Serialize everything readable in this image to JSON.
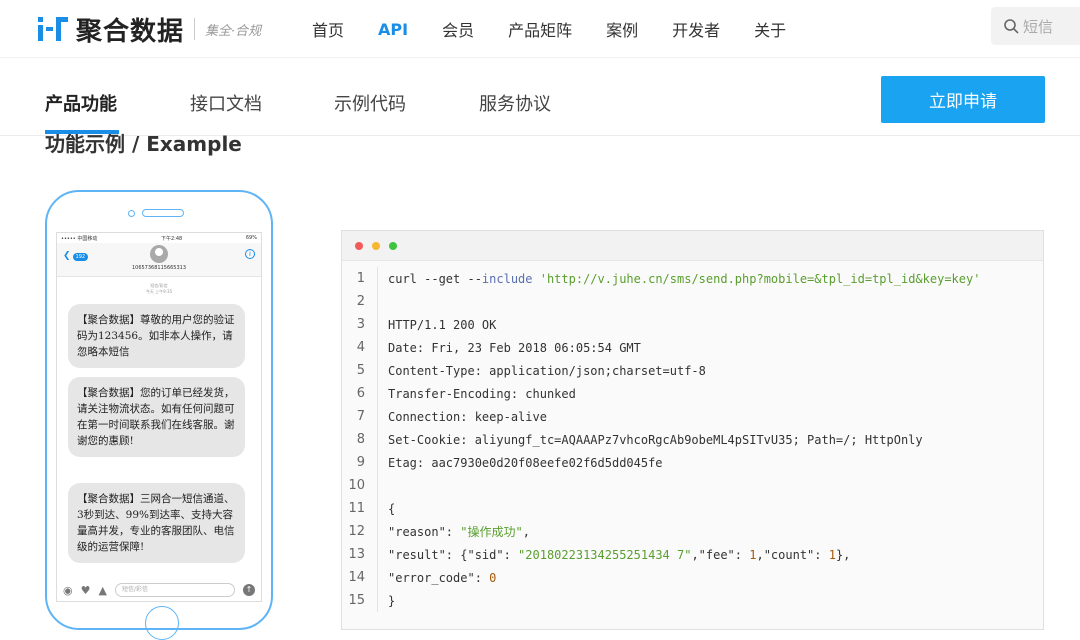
{
  "header": {
    "logo_text": "聚合数据",
    "slogan": "集全·合规",
    "nav": [
      {
        "label": "首页",
        "active": false
      },
      {
        "label": "API",
        "active": true
      },
      {
        "label": "会员",
        "active": false
      },
      {
        "label": "产品矩阵",
        "active": false
      },
      {
        "label": "案例",
        "active": false
      },
      {
        "label": "开发者",
        "active": false
      },
      {
        "label": "关于",
        "active": false
      }
    ],
    "search_placeholder": "短信"
  },
  "subnav": {
    "tabs": [
      "产品功能",
      "接口文档",
      "示例代码",
      "服务协议"
    ],
    "active_index": 0,
    "apply_label": "立即申请"
  },
  "section_title": "功能示例 / Example",
  "phone": {
    "status_left": "••••• 中国移动",
    "status_time": "下午2:48",
    "status_right": "69%",
    "back_badge": "192",
    "sender": "10657368115665313",
    "meta": "短信/彩信\n今天 上午9:35",
    "messages": [
      "【聚合数据】尊敬的用户您的验证码为123456。如非本人操作，请忽略本短信",
      "【聚合数据】您的订单已经发货，请关注物流状态。如有任何问题可在第一时间联系我们在线客服。谢谢您的惠顾!",
      "【聚合数据】三网合一短信通道、3秒到达、99%到达率、支持大容量高并发，专业的客服团队、电信级的运营保障!"
    ],
    "input_placeholder": "短信/彩信"
  },
  "code": {
    "window_dots": [
      "#f25a5a",
      "#f6b731",
      "#3fc43f"
    ],
    "lines": [
      {
        "n": "1",
        "parts": [
          [
            "curl --get --",
            ""
          ],
          [
            "include",
            "kw"
          ],
          [
            " ",
            ""
          ],
          [
            "'http://v.juhe.cn/sms/send.php?mobile=&tpl_id=tpl_id&key=key'",
            "str"
          ]
        ]
      },
      {
        "n": "2",
        "parts": []
      },
      {
        "n": "3",
        "parts": [
          [
            "HTTP/1.1 200 OK",
            ""
          ]
        ]
      },
      {
        "n": "4",
        "parts": [
          [
            "Date: Fri, 23 Feb 2018 06:05:54 GMT",
            ""
          ]
        ]
      },
      {
        "n": "5",
        "parts": [
          [
            "Content-Type: application/json;charset=utf-8",
            ""
          ]
        ]
      },
      {
        "n": "6",
        "parts": [
          [
            "Transfer-Encoding: chunked",
            ""
          ]
        ]
      },
      {
        "n": "7",
        "parts": [
          [
            "Connection: keep-alive",
            ""
          ]
        ]
      },
      {
        "n": "8",
        "parts": [
          [
            "Set-Cookie: aliyungf_tc=AQAAAPz7vhcoRgcAb9obeML4pSITvU35; Path=/; HttpOnly",
            ""
          ]
        ]
      },
      {
        "n": "9",
        "parts": [
          [
            "Etag: aac7930e0d20f08eefe02f6d5dd045fe",
            ""
          ]
        ]
      },
      {
        "n": "10",
        "parts": []
      },
      {
        "n": "11",
        "parts": [
          [
            "{",
            ""
          ]
        ]
      },
      {
        "n": "12",
        "parts": [
          [
            "\"reason\": ",
            ""
          ],
          [
            "\"操作成功\"",
            "str"
          ],
          [
            ",",
            ""
          ]
        ]
      },
      {
        "n": "13",
        "parts": [
          [
            "\"result\": {\"sid\": ",
            ""
          ],
          [
            "\"20180223134255251434 7\"",
            "str"
          ],
          [
            ",\"fee\": ",
            ""
          ],
          [
            "1",
            "num"
          ],
          [
            ",\"count\": ",
            ""
          ],
          [
            "1",
            "num"
          ],
          [
            "},",
            ""
          ]
        ]
      },
      {
        "n": "14",
        "parts": [
          [
            "\"error_code\": ",
            ""
          ],
          [
            "0",
            "num"
          ]
        ]
      },
      {
        "n": "15",
        "parts": [
          [
            "}",
            ""
          ]
        ]
      }
    ]
  }
}
